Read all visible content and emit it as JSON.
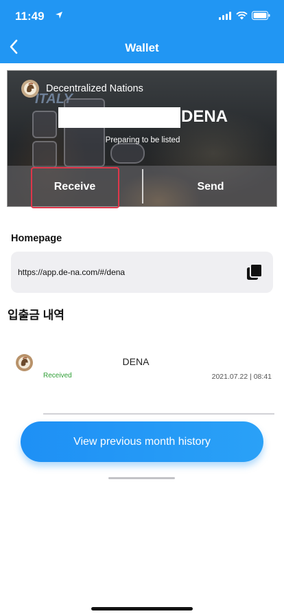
{
  "status_bar": {
    "time": "11:49"
  },
  "header": {
    "title": "Wallet",
    "back_icon": "chevron-left-icon",
    "background_color": "#2196f3"
  },
  "banner": {
    "project_name": "Decentralized Nations",
    "token_symbol": "DENA",
    "listing_status": "Preparing to be listed",
    "background_text": "ITALY",
    "receive_label": "Receive",
    "send_label": "Send",
    "highlight_color": "#e0364a"
  },
  "homepage": {
    "label": "Homepage",
    "url": "https://app.de-na.com/#/dena",
    "copy_icon": "copy-icon"
  },
  "history": {
    "title": "입출금 내역",
    "transactions": [
      {
        "symbol": "DENA",
        "status": "Received",
        "timestamp": "2021.07.22 | 08:41",
        "status_color": "#2e9e35"
      }
    ],
    "previous_month_button": "View previous month history"
  }
}
